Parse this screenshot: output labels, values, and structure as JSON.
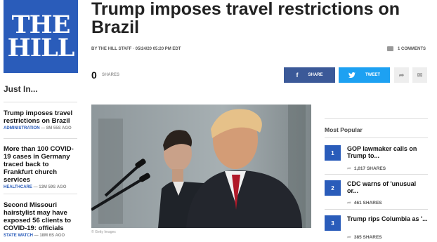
{
  "logo": {
    "line1": "THE",
    "line2": "HILL"
  },
  "sidebar": {
    "title": "Just In...",
    "items": [
      {
        "headline": "Trump imposes travel restrictions on Brazil",
        "category": "ADMINISTRATION",
        "time": "— 8M 55S AGO"
      },
      {
        "headline": "More than 100 COVID-19 cases in Germany traced back to Frankfurt church services",
        "category": "HEALTHCARE",
        "time": "— 13M 59S AGO"
      },
      {
        "headline": "Second Missouri hairstylist may have exposed 56 clients to COVID-19: officials",
        "category": "STATE WATCH",
        "time": "— 18M 6S AGO"
      }
    ]
  },
  "article": {
    "title": "Trump imposes travel restrictions on Brazil",
    "byline": "BY THE HILL STAFF · 05/24/20 05:20 PM EDT",
    "comments": "1 COMMENTS",
    "shares_count": "0",
    "shares_label": "SHARES",
    "share_facebook": "SHARE",
    "share_twitter": "TWEET",
    "photo_credit": "© Getty Images"
  },
  "most_popular": {
    "title": "Most Popular",
    "items": [
      {
        "num": "1",
        "headline": "GOP lawmaker calls on Trump to...",
        "shares": "1,017 SHARES"
      },
      {
        "num": "2",
        "headline": "CDC warns of 'unusual or...",
        "shares": "461 SHARES"
      },
      {
        "num": "3",
        "headline": "Trump rips Columbia as '...",
        "shares": "385 SHARES"
      }
    ]
  },
  "colors": {
    "brand": "#2a5cba",
    "facebook": "#3b5998",
    "twitter": "#1da1f2"
  },
  "icons": {
    "facebook": "facebook-icon",
    "twitter": "twitter-icon",
    "share": "share-arrow-icon",
    "mail": "mail-icon",
    "comment": "comment-icon"
  }
}
